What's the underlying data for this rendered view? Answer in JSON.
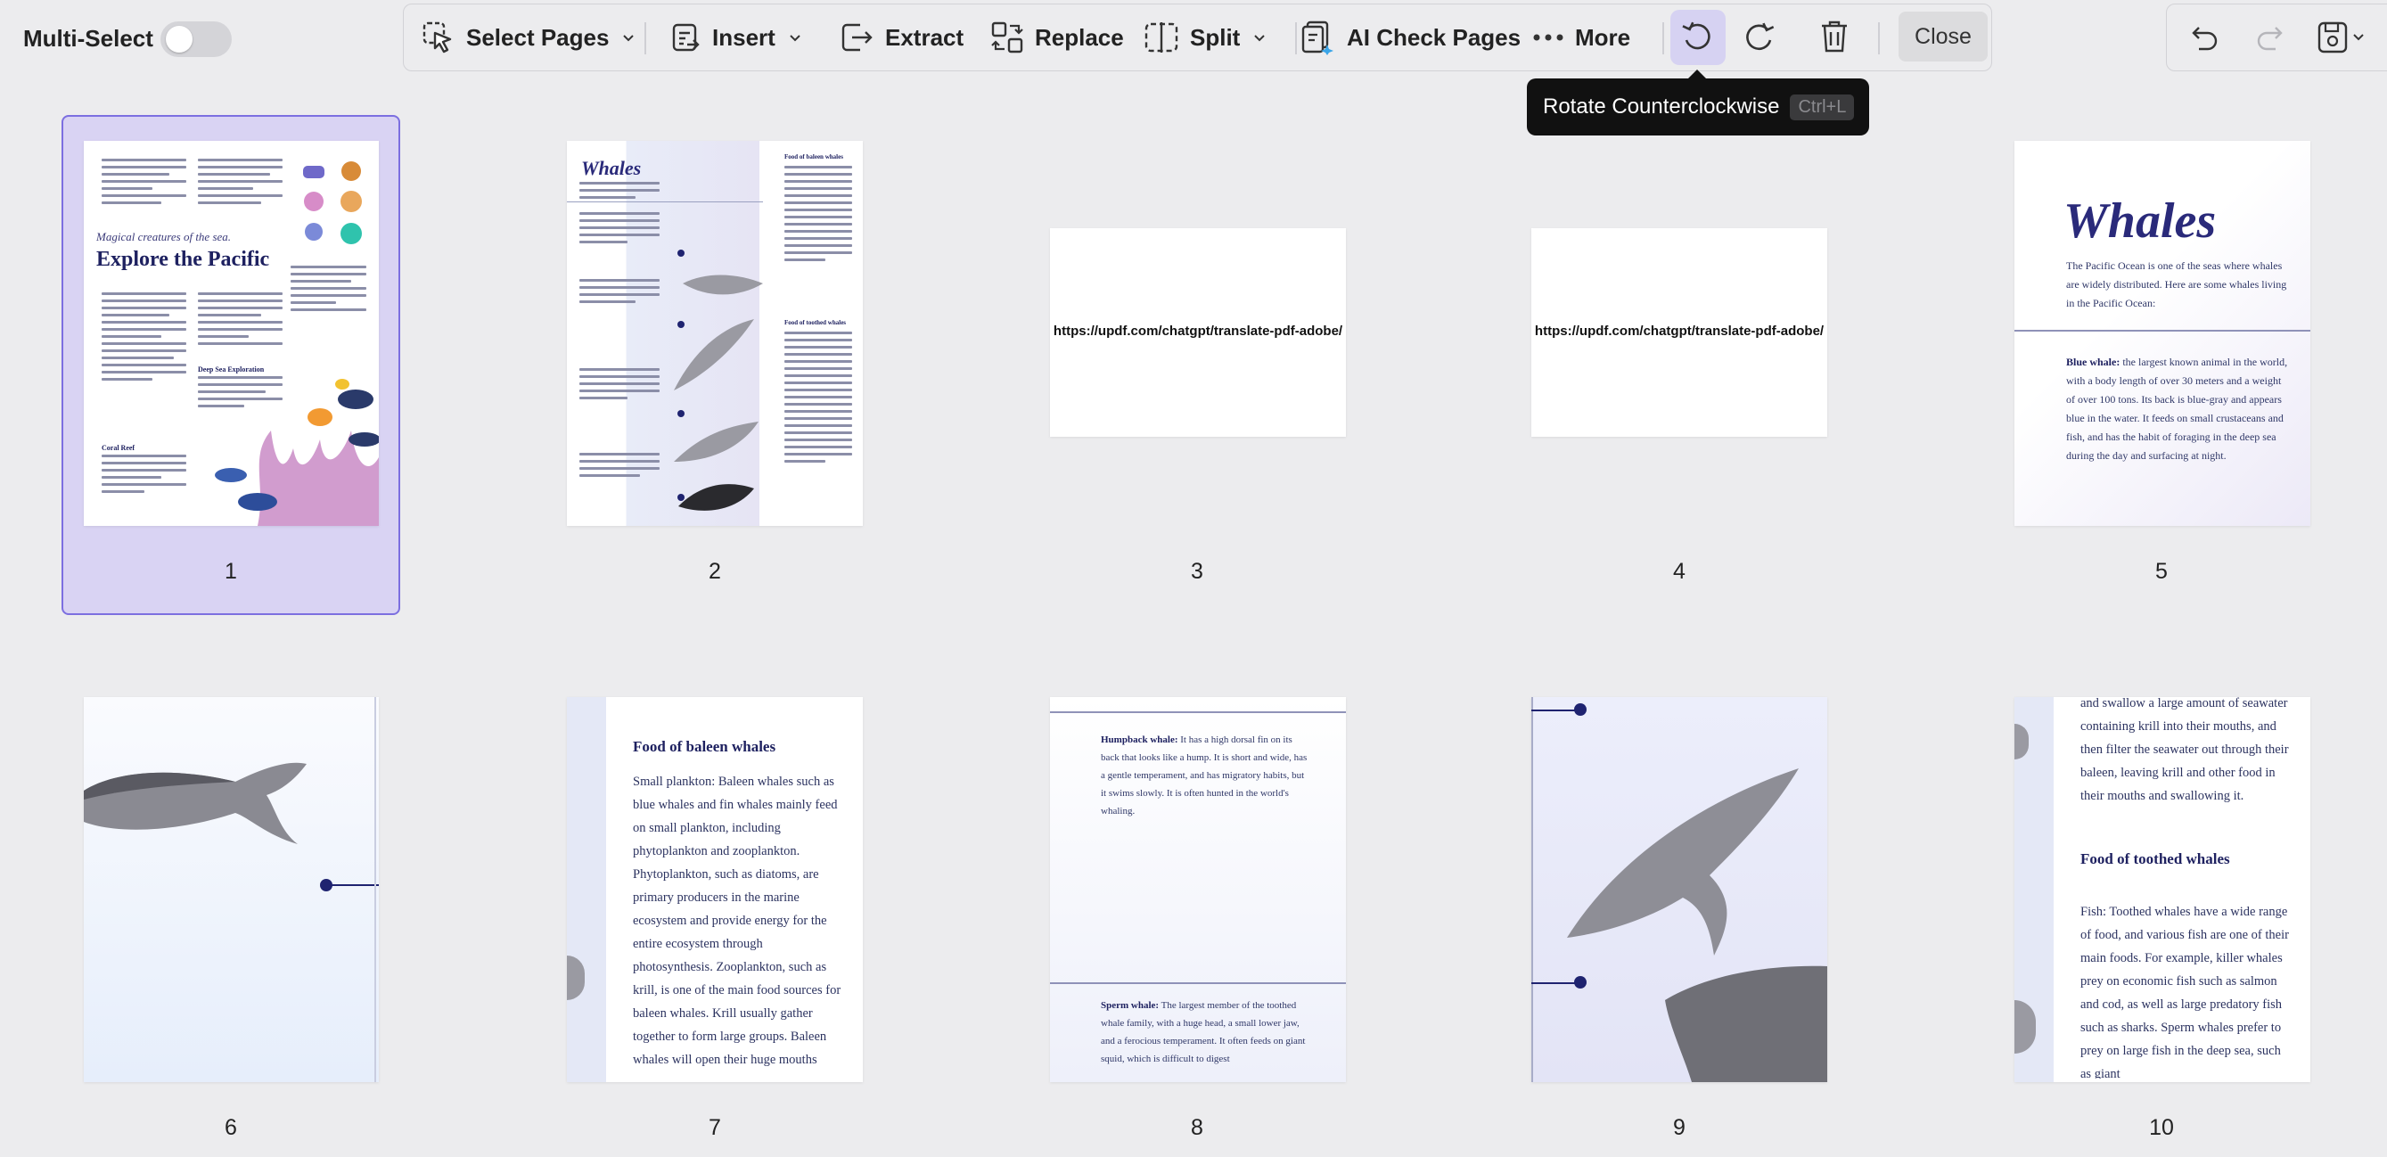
{
  "toolbar": {
    "multi_select_label": "Multi-Select",
    "multi_select_on": false,
    "select_pages_label": "Select Pages",
    "insert_label": "Insert",
    "extract_label": "Extract",
    "replace_label": "Replace",
    "split_label": "Split",
    "ai_check_label": "AI Check Pages",
    "more_label": "More",
    "close_label": "Close",
    "accent_color": "#7c6fe0"
  },
  "tooltip": {
    "text": "Rotate Counterclockwise",
    "shortcut": "Ctrl+L"
  },
  "pages": [
    {
      "number": "1",
      "selected": true,
      "subtitle": "Magical creatures of the sea.",
      "title": "Explore the Pacific",
      "section1": "Deep Sea Exploration",
      "section2": "Coral Reef"
    },
    {
      "number": "2",
      "title": "Whales",
      "heading1": "Food of baleen whales",
      "heading2": "Food of toothed whales"
    },
    {
      "number": "3",
      "url": "https://updf.com/chatgpt/translate-pdf-adobe/"
    },
    {
      "number": "4",
      "url": "https://updf.com/chatgpt/translate-pdf-adobe/"
    },
    {
      "number": "5",
      "title": "Whales",
      "intro": "The Pacific Ocean is one of the seas where whales are widely distributed. Here are some whales living in the Pacific Ocean:",
      "term": "Blue whale:",
      "body": "the largest known animal in the world, with a body length of over 30 meters and a weight of over 100 tons. Its back is blue-gray and appears blue in the water. It feeds on small crustaceans and fish, and has the habit of foraging in the deep sea during the day and surfacing at night."
    },
    {
      "number": "6"
    },
    {
      "number": "7",
      "heading": "Food of baleen whales",
      "body": "Small plankton: Baleen whales such as blue whales and fin whales mainly feed on small plankton, including phytoplankton and zooplankton. Phytoplankton, such as diatoms, are primary producers in the marine ecosystem and provide energy for the entire ecosystem through photosynthesis. Zooplankton, such as krill, is one of the main food sources for baleen whales. Krill usually gather together to form large groups. Baleen whales will open their huge mouths"
    },
    {
      "number": "8",
      "term1": "Humpback whale:",
      "body1": "It has a high dorsal fin on its back that looks like a hump. It is short and wide, has a gentle temperament, and has migratory habits, but it swims slowly. It is often hunted in the world's whaling.",
      "term2": "Sperm whale:",
      "body2": "The largest member of the toothed whale family, with a huge head, a small lower jaw, and a ferocious temperament. It often feeds on giant squid, which is difficult to digest"
    },
    {
      "number": "9"
    },
    {
      "number": "10",
      "body1": "and swallow a large amount of seawater containing krill into their mouths, and then filter the seawater out through their baleen, leaving krill and other food in their mouths and swallowing it.",
      "heading": "Food of toothed whales",
      "body2": "Fish: Toothed whales have a wide range of food, and various fish are one of their main foods. For example, killer whales prey on economic fish such as salmon and cod, as well as large predatory fish such as sharks. Sperm whales prefer to prey on large fish in the deep sea, such as giant"
    }
  ]
}
